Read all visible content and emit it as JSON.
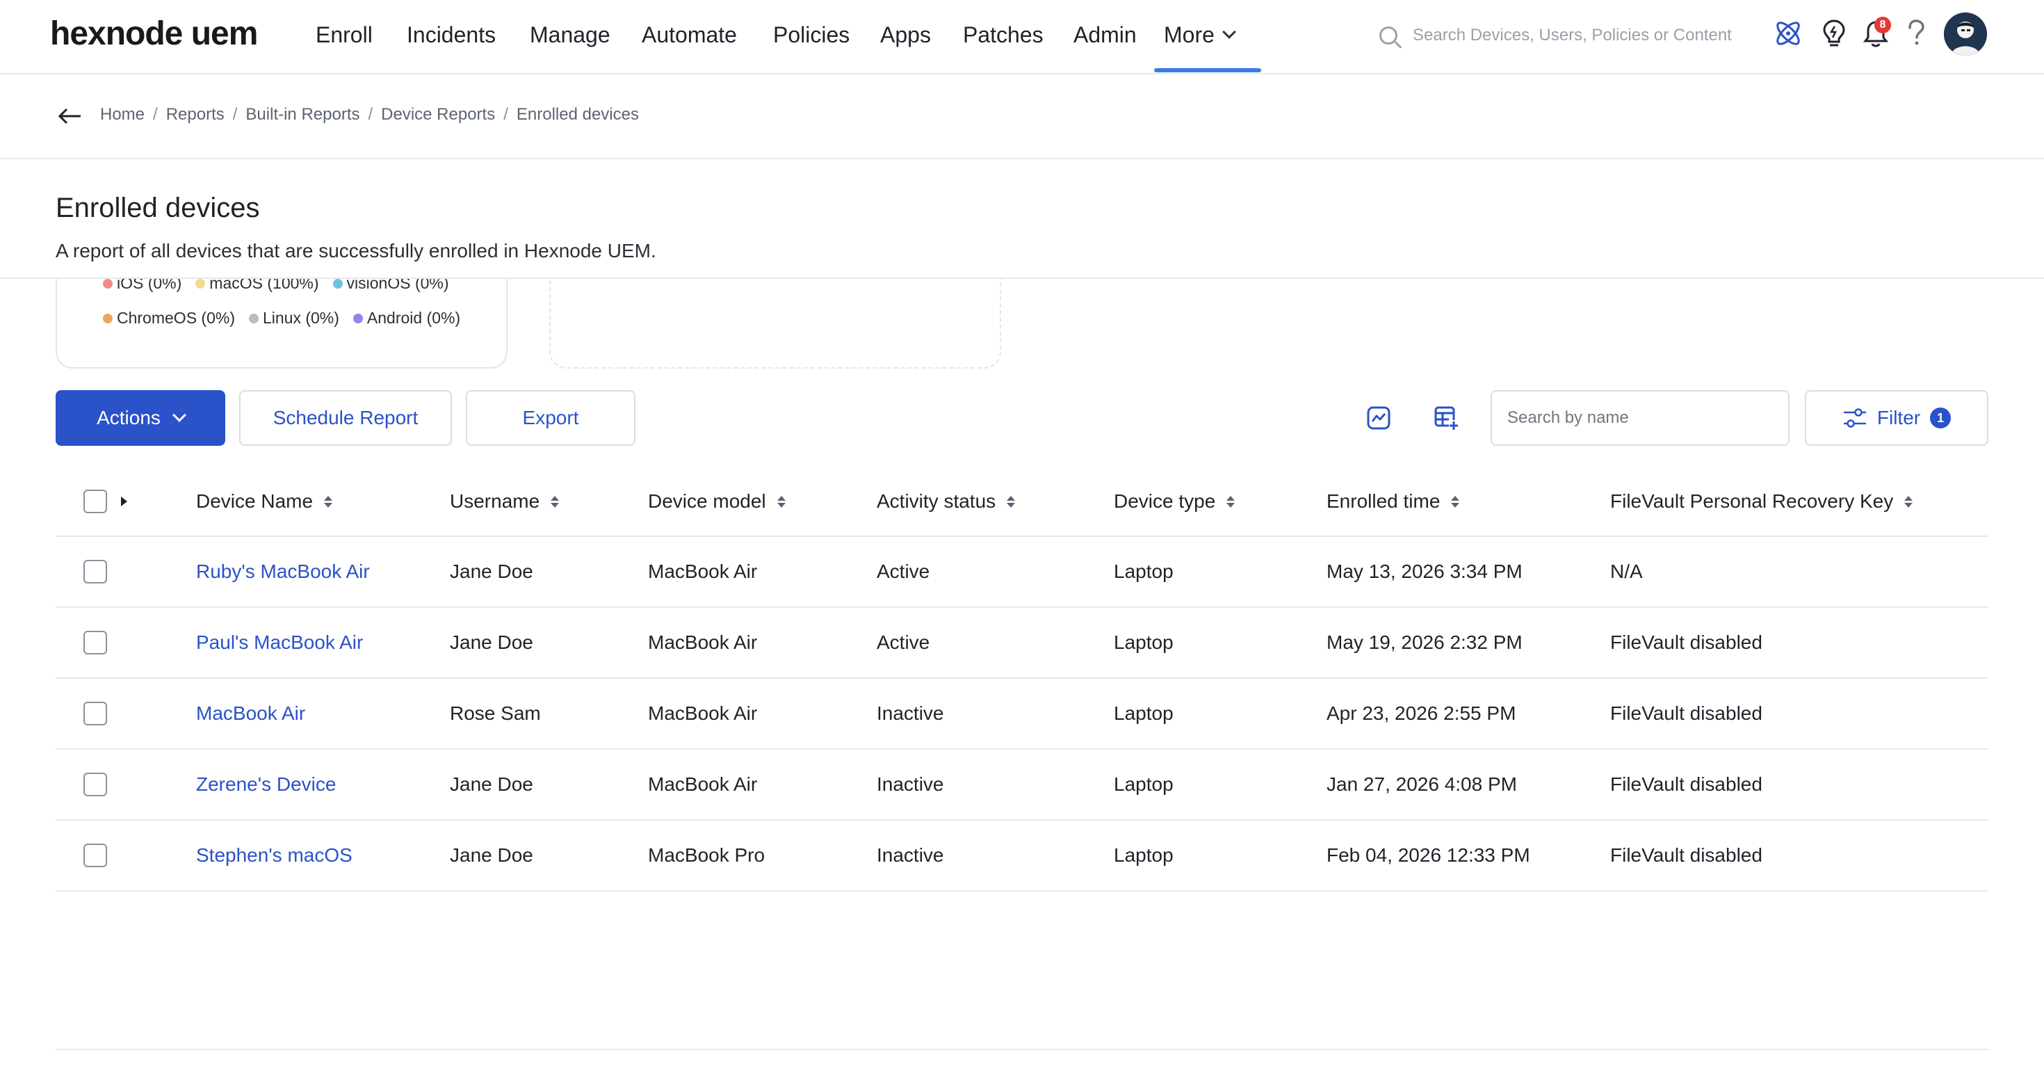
{
  "app": {
    "logo": "hexnode uem"
  },
  "nav": {
    "items": [
      "Enroll",
      "Incidents",
      "Manage",
      "Automate",
      "Policies",
      "Apps",
      "Patches",
      "Admin"
    ],
    "more_label": "More"
  },
  "global_search": {
    "placeholder": "Search Devices, Users, Policies or Content"
  },
  "header_icons": {
    "notifications_count": "8"
  },
  "breadcrumb": [
    "Home",
    "Reports",
    "Built-in Reports",
    "Device Reports",
    "Enrolled devices"
  ],
  "page": {
    "title": "Enrolled devices",
    "description": "A report of all devices that are successfully enrolled in Hexnode UEM."
  },
  "os_legend": {
    "row1": [
      {
        "label": "iOS (0%)",
        "color": "#f08a8a"
      },
      {
        "label": "macOS (100%)",
        "color": "#f3d98a"
      },
      {
        "label": "visionOS (0%)",
        "color": "#6cc3e0"
      }
    ],
    "row2": [
      {
        "label": "ChromeOS (0%)",
        "color": "#f2a65a"
      },
      {
        "label": "Linux (0%)",
        "color": "#b8bcc2"
      },
      {
        "label": "Android (0%)",
        "color": "#8f86ea"
      }
    ]
  },
  "toolbar": {
    "actions_label": "Actions",
    "schedule_label": "Schedule Report",
    "export_label": "Export",
    "search_placeholder": "Search by name",
    "filter_label": "Filter",
    "filter_count": "1"
  },
  "table": {
    "columns": [
      "Device Name",
      "Username",
      "Device model",
      "Activity status",
      "Device type",
      "Enrolled time",
      "FileVault Personal Recovery Key"
    ],
    "rows": [
      {
        "device_name": "Ruby's MacBook Air",
        "username": "Jane Doe",
        "model": "MacBook Air",
        "status": "Active",
        "type": "Laptop",
        "enrolled": "May 13, 2026 3:34 PM",
        "key": "N/A"
      },
      {
        "device_name": "Paul's MacBook Air",
        "username": "Jane Doe",
        "model": "MacBook Air",
        "status": "Active",
        "type": "Laptop",
        "enrolled": "May 19, 2026 2:32 PM",
        "key": "FileVault disabled"
      },
      {
        "device_name": "MacBook Air",
        "username": "Rose Sam",
        "model": "MacBook Air",
        "status": "Inactive",
        "type": "Laptop",
        "enrolled": "Apr 23, 2026 2:55 PM",
        "key": "FileVault disabled"
      },
      {
        "device_name": "Zerene's Device",
        "username": "Jane Doe",
        "model": "MacBook Air",
        "status": "Inactive",
        "type": "Laptop",
        "enrolled": "Jan 27, 2026 4:08 PM",
        "key": "FileVault disabled"
      },
      {
        "device_name": "Stephen's macOS",
        "username": "Jane Doe",
        "model": "MacBook Pro",
        "status": "Inactive",
        "type": "Laptop",
        "enrolled": "Feb 04, 2026 12:33 PM",
        "key": "FileVault disabled"
      }
    ]
  },
  "colors": {
    "primary": "#2a52c9",
    "link": "#2a52c9",
    "nav_active_underline": "#3d7be0",
    "badge_red": "#e53935"
  }
}
